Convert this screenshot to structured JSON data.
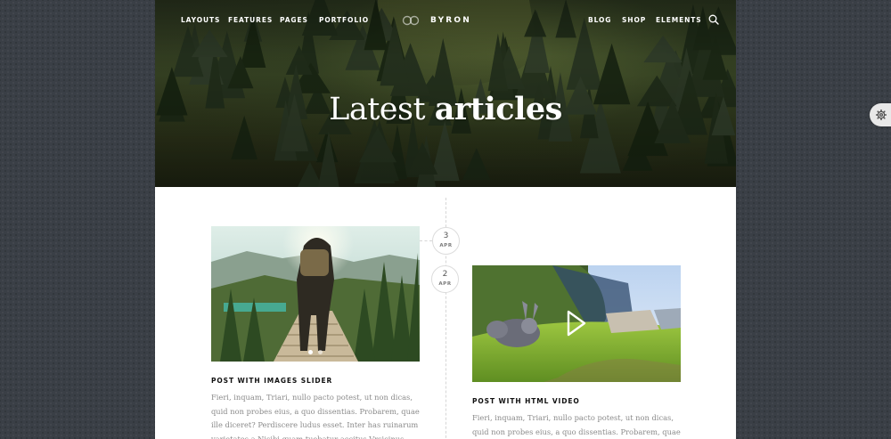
{
  "nav": {
    "left_items": [
      "LAYOUTS",
      "FEATURES",
      "PAGES",
      "PORTFOLIO"
    ],
    "right_items": [
      "BLOG",
      "SHOP",
      "ELEMENTS"
    ],
    "logo_text": "BYRON",
    "search_icon": "search-icon"
  },
  "hero": {
    "title_light": "Latest",
    "title_bold": "articles"
  },
  "posts": [
    {
      "date_day": "3",
      "date_month": "APR",
      "title": "POST WITH IMAGES SLIDER",
      "excerpt": "Fieri, inquam, Triari, nullo pacto potest, ut non dicas, quid non probes eius, a quo dissentias. Probarem, quae ille diceret? Perdiscere ludus esset. Inter has ruinarum varietates a Nisibi quam tuebatur accitus Vrsicinus, cui nos obsecuturos iunxerat",
      "media": "image-slider",
      "slider_dots": 2,
      "active_dot": 0
    },
    {
      "date_day": "2",
      "date_month": "APR",
      "title": "POST WITH HTML VIDEO",
      "excerpt": "Fieri, inquam, Triari, nullo pacto potest, ut non dicas, quid non probes eius, a quo dissentias. Probarem, quae ille diceret?",
      "media": "video",
      "play_icon": "play-icon"
    }
  ],
  "settings_icon": "gear-icon",
  "colors": {
    "frame_background": "#3a3f46",
    "page_background": "#ffffff",
    "title_text": "#111111",
    "excerpt_text": "#8a8a8a"
  }
}
